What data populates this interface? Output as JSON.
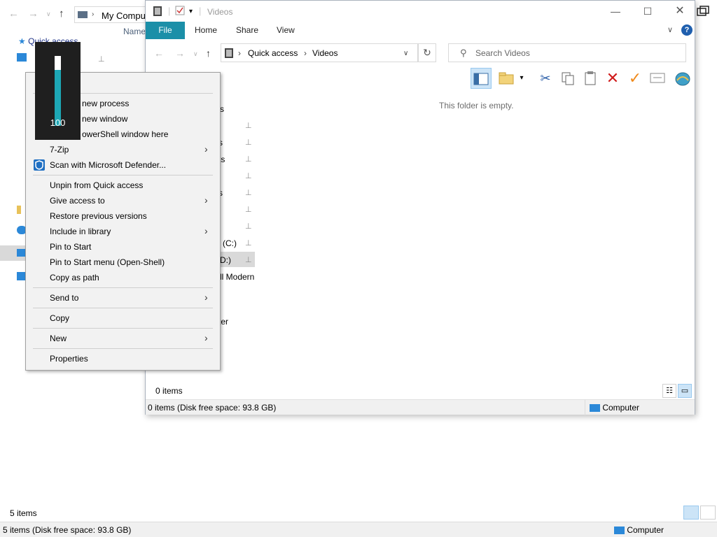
{
  "background_window": {
    "address_text": "My Comput",
    "column_header": "Name",
    "quick_access_label": "Quick access",
    "items_count": "5 items",
    "status_left": "5 items (Disk free space: 93.8 GB)",
    "status_right": "Computer"
  },
  "videos_window": {
    "title": "Videos",
    "tabs": [
      "File",
      "Home",
      "Share",
      "View"
    ],
    "breadcrumb": [
      "Quick access",
      "Videos"
    ],
    "search_placeholder": "Search Videos",
    "empty_message": "This folder is empty.",
    "items_count": "0 items",
    "status_left": "0 items (Disk free space: 93.8 GB)",
    "status_right": "Computer",
    "nav_fragments": [
      "ss",
      "s",
      "ts",
      "s",
      "(C:)",
      "D:)",
      "ll Modern",
      "ter"
    ]
  },
  "context_menu": {
    "items": [
      {
        "label": "new process",
        "group": 1
      },
      {
        "label": "new window",
        "group": 1
      },
      {
        "label": "owerShell window here",
        "group": 1
      },
      {
        "label": "7-Zip",
        "group": 1
      },
      {
        "label": "Scan with Microsoft Defender...",
        "group": 1
      },
      {
        "label": "Unpin from Quick access",
        "group": 2
      },
      {
        "label": "Give access to",
        "group": 2
      },
      {
        "label": "Restore previous versions",
        "group": 2
      },
      {
        "label": "Include in library",
        "group": 2
      },
      {
        "label": "Pin to Start",
        "group": 2
      },
      {
        "label": "Pin to Start menu (Open-Shell)",
        "group": 2
      },
      {
        "label": "Copy as path",
        "group": 2
      },
      {
        "label": "Send to",
        "group": 3
      },
      {
        "label": "Copy",
        "group": 4
      },
      {
        "label": "New",
        "group": 5
      },
      {
        "label": "Properties",
        "group": 6
      }
    ]
  },
  "volume_osd": {
    "value": "100",
    "level": 1.0
  },
  "colors": {
    "file_tab": "#1b8fa8",
    "volume_fill": "#1da7b5",
    "delete_red": "#d01c1c",
    "check_orange": "#f08a1c"
  }
}
